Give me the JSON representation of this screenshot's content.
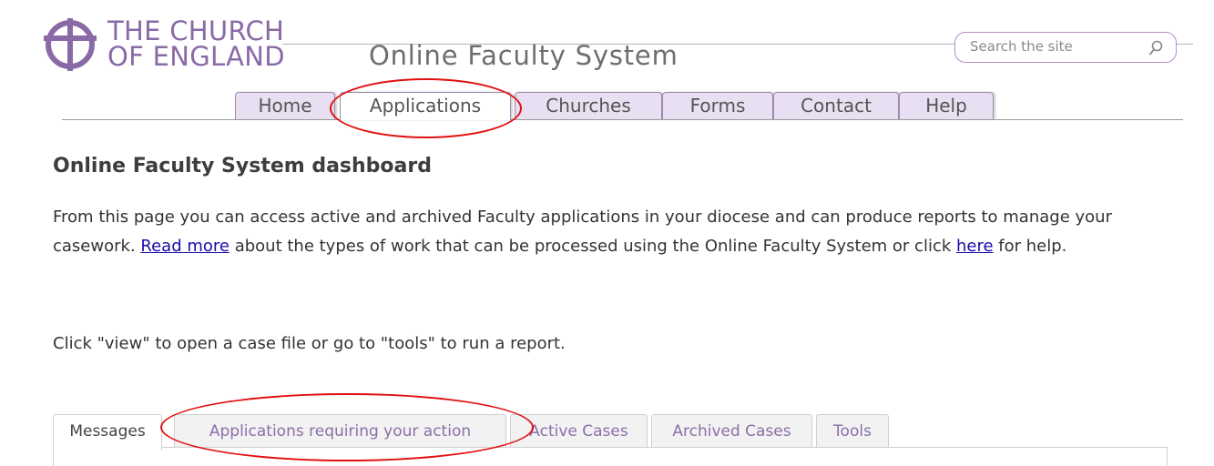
{
  "logo": {
    "line1": "THE CHURCH",
    "line2": "OF ENGLAND",
    "icon": "church-cross-logo-icon",
    "color": "#8a6aa6"
  },
  "site_title": "Online Faculty System",
  "search": {
    "placeholder": "Search the site",
    "icon": "search-icon",
    "border_color": "#b58cc9"
  },
  "nav": {
    "tabs": [
      {
        "label": "Home",
        "active": false
      },
      {
        "label": "Applications",
        "active": true
      },
      {
        "label": "Churches",
        "active": false
      },
      {
        "label": "Forms",
        "active": false
      },
      {
        "label": "Contact",
        "active": false
      },
      {
        "label": "Help",
        "active": false
      }
    ],
    "tab_color": "#e8dff2"
  },
  "main": {
    "title": "Online Faculty System dashboard",
    "intro": {
      "part1": "From this page you can access active and archived Faculty applications in your diocese and can produce reports to manage your casework. ",
      "link1": "Read more",
      "part2": " about the types of work that can be processed using the Online Faculty System or click ",
      "link2": "here",
      "part3": " for help."
    },
    "instruction": "Click \"view\" to open a case file or go to \"tools\" to run a report."
  },
  "subtabs": [
    {
      "label": "Messages",
      "active": true
    },
    {
      "label": "Applications requiring your action",
      "active": false
    },
    {
      "label": "Active Cases",
      "active": false
    },
    {
      "label": "Archived Cases",
      "active": false
    },
    {
      "label": "Tools",
      "active": false
    }
  ],
  "annotation_color": "#e11010"
}
